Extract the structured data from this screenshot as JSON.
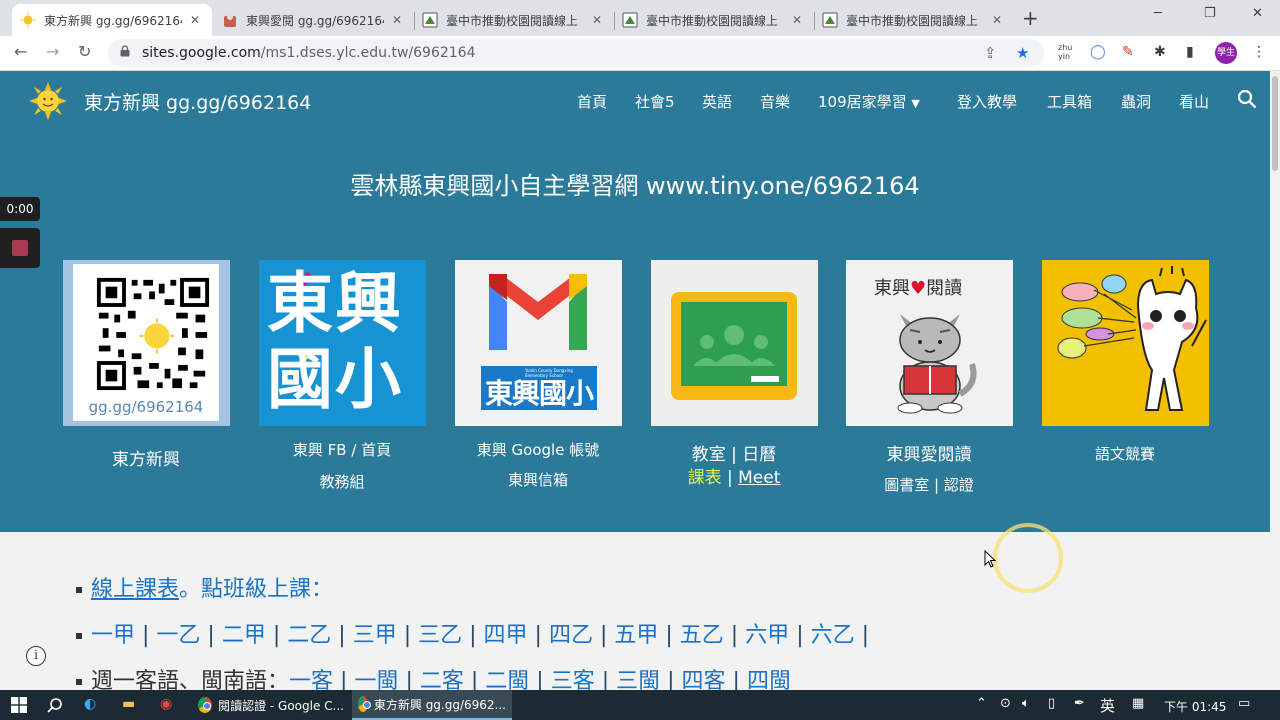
{
  "browser": {
    "tabs": [
      {
        "title": "東方新興 gg.gg/6962164",
        "active": true,
        "icon": "sun-favicon"
      },
      {
        "title": "東興愛閱 gg.gg/6962164",
        "active": false,
        "icon": "cat-favicon"
      },
      {
        "title": "臺中市推動校園閱讀線上",
        "active": false,
        "icon": "reading-favicon"
      },
      {
        "title": "臺中市推動校園閱讀線上",
        "active": false,
        "icon": "reading-favicon"
      },
      {
        "title": "臺中市推動校園閱讀線上",
        "active": false,
        "icon": "reading-favicon"
      }
    ],
    "new_tab": "+",
    "url_host": "sites.google.com",
    "url_path": "/ms1.dses.ylc.edu.tw/6962164",
    "ext_zhuyin": "zhu yin",
    "profile_label": "學生"
  },
  "site": {
    "title": "東方新興 gg.gg/6962164",
    "nav": [
      "首頁",
      "社會5",
      "英語",
      "音樂",
      "109居家學習",
      "登入教學",
      "工具箱",
      "蟲洞",
      "看山"
    ],
    "hero_title": "雲林縣東興國小自主學習網  www.tiny.one/6962164"
  },
  "cards": [
    {
      "name": "qr",
      "qr_caption": "gg.gg/6962164",
      "line1": "東方新興"
    },
    {
      "name": "fb",
      "tile_text": "東興國小",
      "line1": "東興 FB / 首頁",
      "line2": "教務組"
    },
    {
      "name": "gmail",
      "tile_text": "東興國小",
      "tile_subtext": "Yunlin County Dongxing Elementary School",
      "line1": "東興 Google 帳號",
      "line2": "東興信箱"
    },
    {
      "name": "classroom",
      "line1": "教室 | 日曆",
      "line2a": "課表",
      "line2b": "|",
      "line2c": "Meet"
    },
    {
      "name": "reading",
      "tile_text_a": "東興",
      "tile_text_b": "閱讀",
      "line1": "東興愛閱讀",
      "line2": "圖書室 | 認證"
    },
    {
      "name": "language",
      "line1": "語文競賽"
    }
  ],
  "lower": {
    "row1": {
      "link": "線上課表",
      "text": "。點班級上課："
    },
    "row2": [
      "一甲",
      "一乙",
      "二甲",
      "二乙",
      "三甲",
      "三乙",
      "四甲",
      "四乙",
      "五甲",
      "五乙",
      "六甲",
      "六乙"
    ],
    "row3": {
      "prefix": "週一客語、閩南語：",
      "links": [
        "一客",
        "一閩",
        "二客",
        "二閩",
        "三客",
        "三閩",
        "四客",
        "四閩"
      ]
    },
    "separator": "|"
  },
  "recorder": {
    "time": "0:00"
  },
  "taskbar": {
    "apps": [
      {
        "label": "閱讀認證 - Google C...",
        "active": false
      },
      {
        "label": "東方新興 gg.gg/6962...",
        "active": true
      }
    ],
    "ime": "英",
    "clock": "下午 01:45"
  }
}
